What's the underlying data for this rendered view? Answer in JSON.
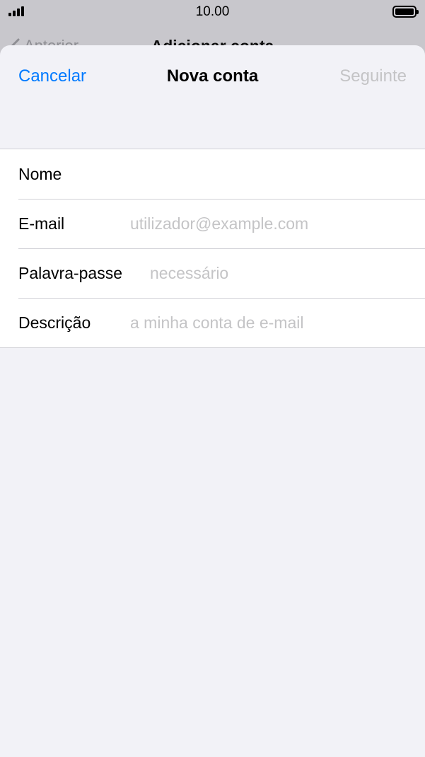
{
  "status_bar": {
    "time": "10.00",
    "signal_icon": "cellular-signal-icon",
    "battery_icon": "battery-full-icon"
  },
  "background_nav": {
    "back_label": "Anterior",
    "title": "Adicionar conta"
  },
  "sheet": {
    "cancel_label": "Cancelar",
    "title": "Nova conta",
    "next_label": "Seguinte"
  },
  "form": {
    "name": {
      "label": "Nome",
      "value": "",
      "placeholder": ""
    },
    "email": {
      "label": "E-mail",
      "value": "",
      "placeholder": "utilizador@example.com"
    },
    "password": {
      "label": "Palavra-passe",
      "value": "",
      "placeholder": "necessário"
    },
    "description": {
      "label": "Descrição",
      "value": "",
      "placeholder": "a minha conta de e-mail"
    }
  },
  "colors": {
    "accent": "#007aff",
    "disabled": "#c4c4c6",
    "background": "#f2f2f7"
  }
}
